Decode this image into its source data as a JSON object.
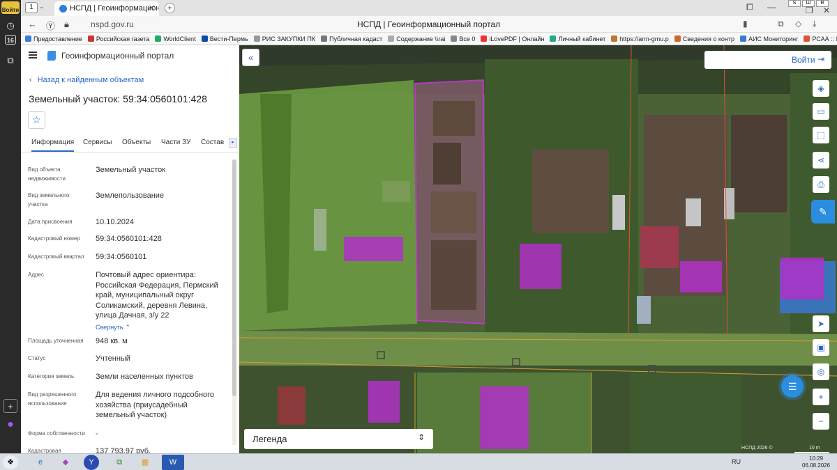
{
  "browser": {
    "tab_count": "1",
    "tab_title": "НСПД | Геоинформационный портал",
    "window_title": "НСПД | Геоинформационный портал",
    "url": "nspd.gov.ru",
    "os_login": "Войти",
    "os_badge": "16",
    "corner_keys": [
      "S",
      "Ш",
      "R"
    ],
    "bookmarks": [
      {
        "label": "Предоставление",
        "color": "#3a7bd5"
      },
      {
        "label": "Российская газета",
        "color": "#c33"
      },
      {
        "label": "WorldClient",
        "color": "#2a6"
      },
      {
        "label": "Вести-Пермь",
        "color": "#124a9e"
      },
      {
        "label": "РИС ЗАКУПКИ ПК",
        "color": "#999"
      },
      {
        "label": "Публичная кадаст",
        "color": "#777"
      },
      {
        "label": "Содержание \\\\rai",
        "color": "#aaa"
      },
      {
        "label": "Все 0",
        "color": "#888"
      },
      {
        "label": "iLovePDF | Онлайн",
        "color": "#e33"
      },
      {
        "label": "Личный кабинет",
        "color": "#2a8"
      },
      {
        "label": "https://arm-gmu.p",
        "color": "#b73"
      },
      {
        "label": "Сведения о контр",
        "color": "#c63"
      },
      {
        "label": "АИС Мониторинг",
        "color": "#3a7bd5"
      },
      {
        "label": "РСАА :: Информа",
        "color": "#d53"
      }
    ]
  },
  "panel": {
    "portal_title": "Геоинформационный портал",
    "back_link": "Назад к найденным объектам",
    "object_title": "Земельный участок: 59:34:0560101:428",
    "tabs": [
      "Информация",
      "Сервисы",
      "Объекты",
      "Части ЗУ",
      "Состав"
    ],
    "properties": [
      {
        "label": "Вид объекта недвижимости",
        "value": "Земельный участок"
      },
      {
        "label": "Вид земельного участка",
        "value": "Землепользование"
      },
      {
        "label": "Дата присвоения",
        "value": "10.10.2024"
      },
      {
        "label": "Кадастровый номер",
        "value": "59:34:0560101:428"
      },
      {
        "label": "Кадастровый квартал",
        "value": "59:34:0560101"
      },
      {
        "label": "Адрес",
        "value": "Почтовый адрес ориентира: Российская Федерация, Пермский край, муниципальный округ Соликамский, деревня Левина, улица Дачная, з/у 22"
      },
      {
        "label": "Площадь уточненная",
        "value": "948 кв. м"
      },
      {
        "label": "Статус",
        "value": "Учтенный"
      },
      {
        "label": "Категория земель",
        "value": "Земли населенных пунктов"
      },
      {
        "label": "Вид разрешенного использования",
        "value": "Для ведения личного подсобного хозяйства (приусадебный земельный участок)"
      },
      {
        "label": "Форма собственности",
        "value": "-"
      },
      {
        "label": "Кадастровая",
        "value": "137 793,97 руб."
      }
    ],
    "collapse_label": "Свернуть"
  },
  "map": {
    "login_label": "Войти",
    "legend_label": "Легенда",
    "copyright": "НСПД 2026 ©",
    "scale_label": "10 m"
  },
  "taskbar": {
    "lang": "RU",
    "time": "10:29",
    "date": "06.08.2026"
  }
}
